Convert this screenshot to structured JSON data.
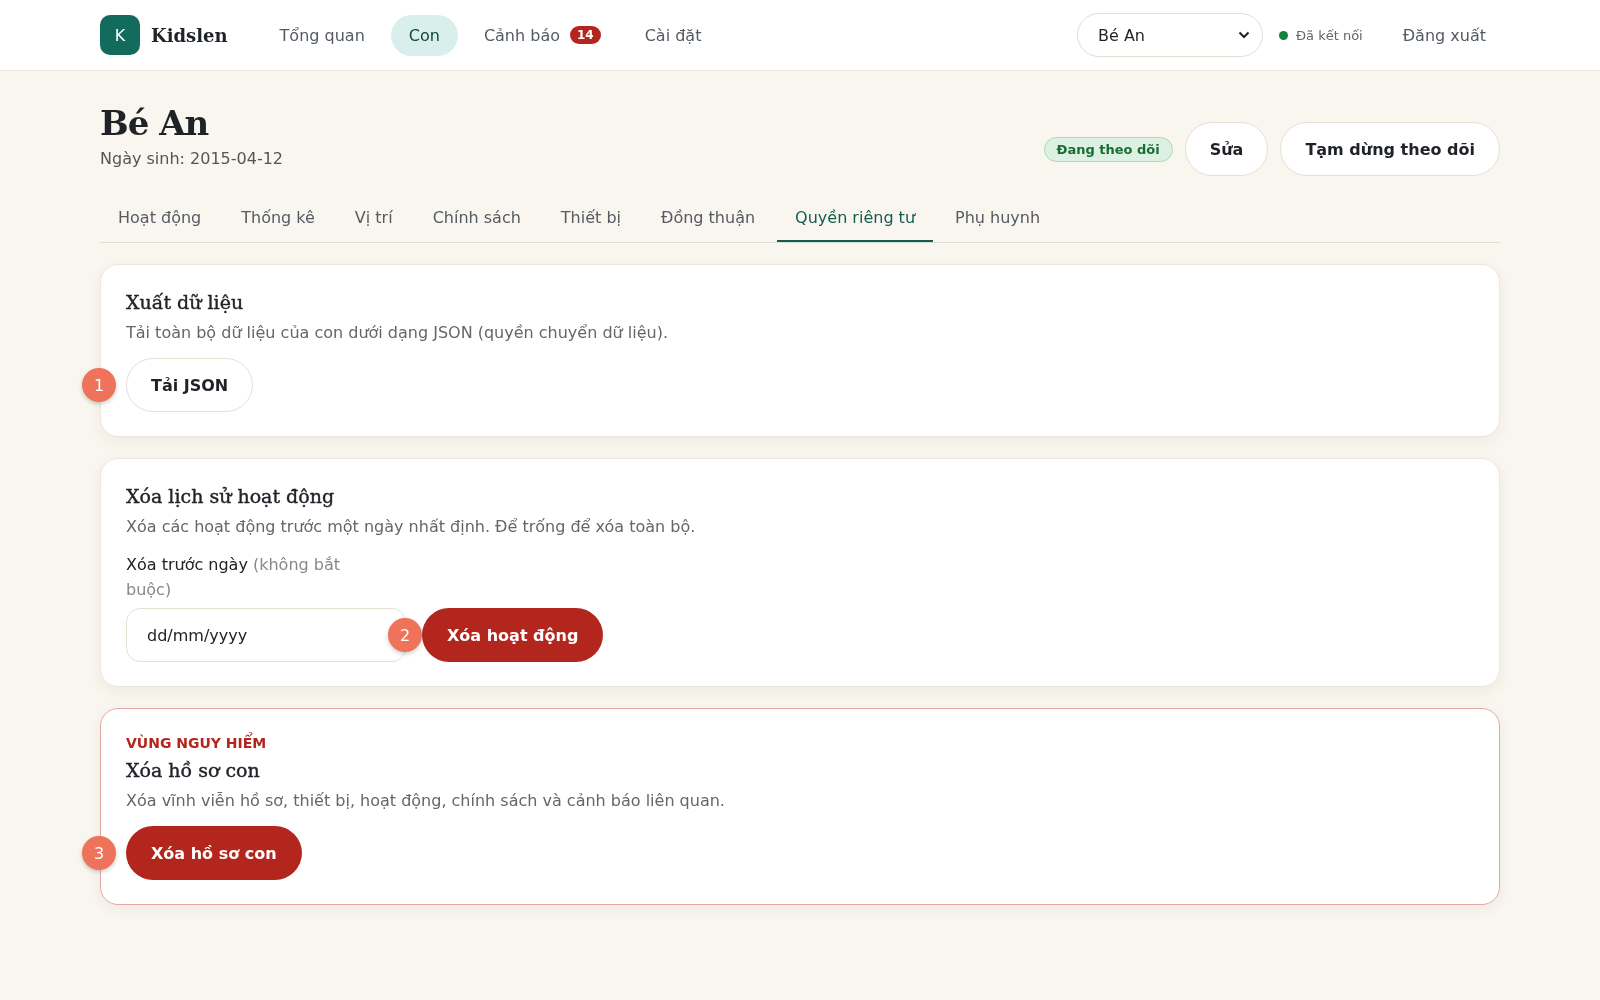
{
  "header": {
    "logo_letter": "K",
    "brand": "Kidslen",
    "nav": [
      {
        "label": "Tổng quan",
        "selected": false
      },
      {
        "label": "Con",
        "selected": true
      },
      {
        "label": "Cảnh báo",
        "selected": false,
        "badge": "14"
      },
      {
        "label": "Cài đặt",
        "selected": false
      }
    ],
    "child_select": {
      "value": "Bé An"
    },
    "connection": {
      "label": "Đã kết nối",
      "connected": true
    },
    "logout": "Đăng xuất"
  },
  "profile": {
    "name": "Bé An",
    "birth": "Ngày sinh: 2015-04-12",
    "status": "Đang theo dõi",
    "actions": [
      "Sửa",
      "Tạm dừng theo dõi"
    ]
  },
  "tabs": [
    {
      "label": "Hoạt động",
      "selected": false
    },
    {
      "label": "Thống kê",
      "selected": false
    },
    {
      "label": "Vị trí",
      "selected": false
    },
    {
      "label": "Chính sách",
      "selected": false
    },
    {
      "label": "Thiết bị",
      "selected": false
    },
    {
      "label": "Đồng thuận",
      "selected": false
    },
    {
      "label": "Quyền riêng tư",
      "selected": true
    },
    {
      "label": "Phụ huynh",
      "selected": false
    }
  ],
  "cards": [
    {
      "kind": "export",
      "title": "Xuất dữ liệu",
      "description": "Tải toàn bộ dữ liệu của con dưới dạng JSON (quyền chuyển dữ liệu).",
      "button": "Tải JSON",
      "marker": "1"
    },
    {
      "kind": "clear",
      "title": "Xóa lịch sử hoạt động",
      "description": "Xóa các hoạt động trước một ngày nhất định. Để trống để xóa toàn bộ.",
      "field_label": "Xóa trước ngày",
      "field_hint": "(không bắt buộc)",
      "placeholder": "dd/mm/yyyy",
      "button": "Xóa hoạt động",
      "marker": "2"
    },
    {
      "kind": "danger",
      "eyebrow": "VÙNG NGUY HIỂM",
      "title": "Xóa hồ sơ con",
      "description": "Xóa vĩnh viễn hồ sơ, thiết bị, hoạt động, chính sách và cảnh báo liên quan.",
      "button": "Xóa hồ sơ con",
      "marker": "3"
    }
  ]
}
